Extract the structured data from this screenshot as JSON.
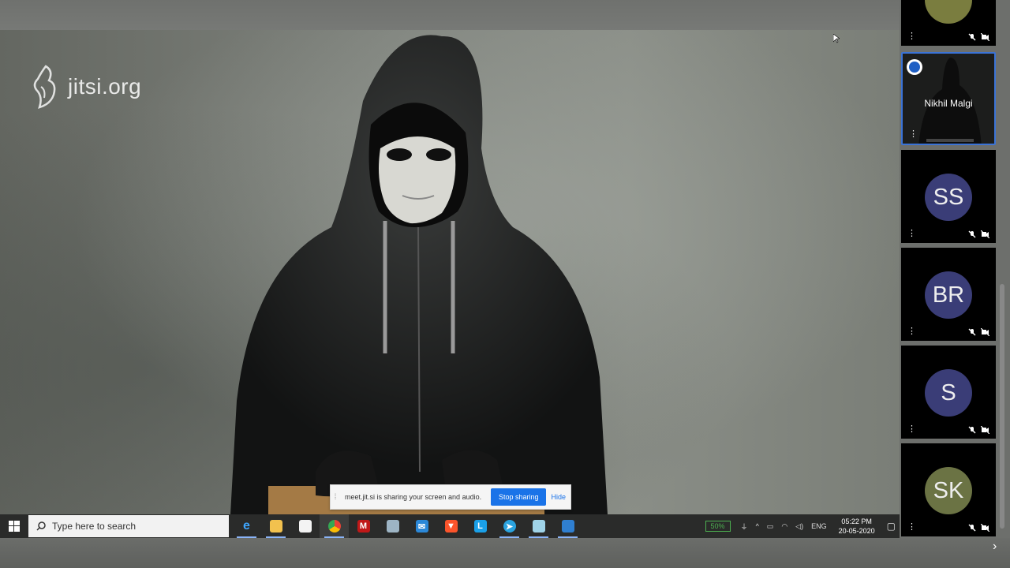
{
  "brand": {
    "logo_text": "jitsi.org"
  },
  "share_bar": {
    "message": "meet.jit.si is sharing your screen and audio.",
    "stop_label": "Stop sharing",
    "hide_label": "Hide"
  },
  "taskbar": {
    "search_placeholder": "Type here to search",
    "pinned_icons": [
      "edge-icon",
      "file-explorer-icon",
      "store-icon",
      "chrome-icon",
      "mcafee-icon",
      "paint-icon",
      "mail-icon",
      "brave-icon",
      "l-app-icon",
      "telegram-icon",
      "notes-icon",
      "photos-icon"
    ],
    "active_app": "chrome-icon",
    "battery": "50%",
    "language": "ENG",
    "time": "05:22 PM",
    "date": "20-05-2020"
  },
  "participants": [
    {
      "initials": "",
      "avatar_color": "#7a7d3f",
      "muted": true,
      "video_off": true,
      "partial": true
    },
    {
      "name": "Nikhil Malgi",
      "dominant_speaker": true,
      "active": true
    },
    {
      "initials": "SS",
      "avatar_color": "#3a3d77",
      "muted": true,
      "video_off": true
    },
    {
      "initials": "BR",
      "avatar_color": "#3a3d77",
      "muted": true,
      "video_off": true
    },
    {
      "initials": "S",
      "avatar_color": "#3a3d77",
      "muted": true,
      "video_off": true
    },
    {
      "initials": "SK",
      "avatar_color": "#6b7344",
      "muted": true,
      "video_off": true
    }
  ]
}
